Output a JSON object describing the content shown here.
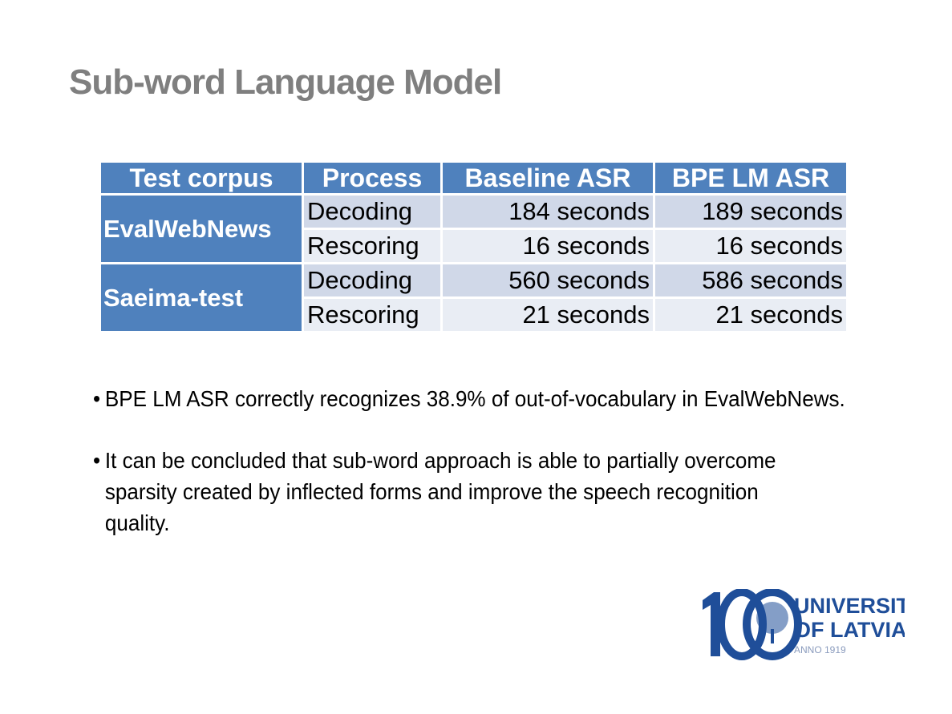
{
  "slide": {
    "title": "Sub-word Language Model"
  },
  "table": {
    "headers": [
      "Test corpus",
      "Process",
      "Baseline ASR",
      "BPE LM ASR"
    ],
    "groups": [
      {
        "corpus": "EvalWebNews",
        "rows": [
          {
            "process": "Decoding",
            "baseline": "184 seconds",
            "bpe": "189 seconds"
          },
          {
            "process": "Rescoring",
            "baseline": "16 seconds",
            "bpe": "16 seconds"
          }
        ]
      },
      {
        "corpus": "Saeima-test",
        "rows": [
          {
            "process": "Decoding",
            "baseline": "560 seconds",
            "bpe": "586 seconds"
          },
          {
            "process": "Rescoring",
            "baseline": "21 seconds",
            "bpe": "21 seconds"
          }
        ]
      }
    ]
  },
  "bullets": [
    {
      "marker": "•",
      "text": "BPE LM ASR correctly recognizes 38.9% of out-of-vocabulary in EvalWebNews."
    },
    {
      "marker": "•",
      "text": "It can be concluded that sub-word approach is able to partially overcome sparsity created by inflected forms and improve the speech recognition quality."
    }
  ],
  "logo": {
    "number": "100",
    "line1": "UNIVERSITY",
    "line2": "OF LATVIA",
    "line3": "ANNO 1919"
  },
  "colors": {
    "header_blue": "#4f81bd",
    "row_dark": "#d0d8e8",
    "row_light": "#e9edf4",
    "title_gray": "#7f7f7f",
    "logo_blue": "#1f4e99"
  }
}
